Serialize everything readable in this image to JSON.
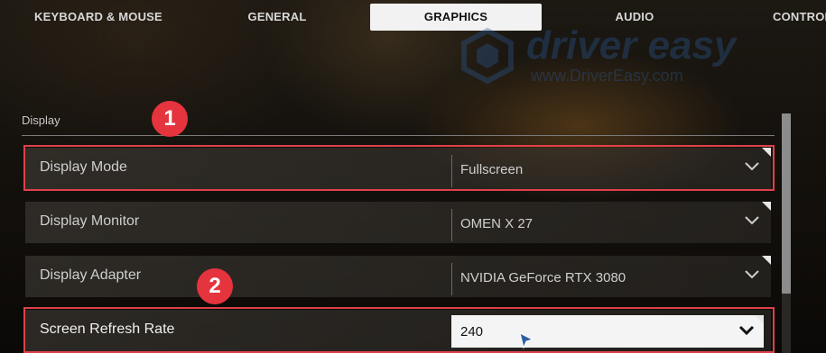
{
  "tabs": [
    {
      "label": "KEYBOARD & MOUSE",
      "active": false
    },
    {
      "label": "GENERAL",
      "active": false
    },
    {
      "label": "GRAPHICS",
      "active": true
    },
    {
      "label": "AUDIO",
      "active": false
    },
    {
      "label": "CONTROLLER",
      "active": false
    }
  ],
  "watermark": {
    "title": "driver easy",
    "url": "www.DriverEasy.com"
  },
  "section": {
    "title": "Display"
  },
  "settings": [
    {
      "label": "Display Mode",
      "value": "Fullscreen",
      "highlighted": true
    },
    {
      "label": "Display Monitor",
      "value": "OMEN X 27",
      "highlighted": false
    },
    {
      "label": "Display Adapter",
      "value": "NVIDIA GeForce RTX 3080",
      "highlighted": false
    },
    {
      "label": "Screen Refresh Rate",
      "value": "240",
      "highlighted": true,
      "focused": true
    }
  ],
  "annotations": {
    "step1": "1",
    "step2": "2"
  },
  "icons": {
    "dropdown": "chevron-down-icon",
    "cursor": "mouse-pointer-icon",
    "logo": "driver-easy-logo-icon"
  },
  "colors": {
    "highlight": "#e0404a",
    "badge": "#e5343d",
    "active_tab": "#f2f2f2"
  }
}
